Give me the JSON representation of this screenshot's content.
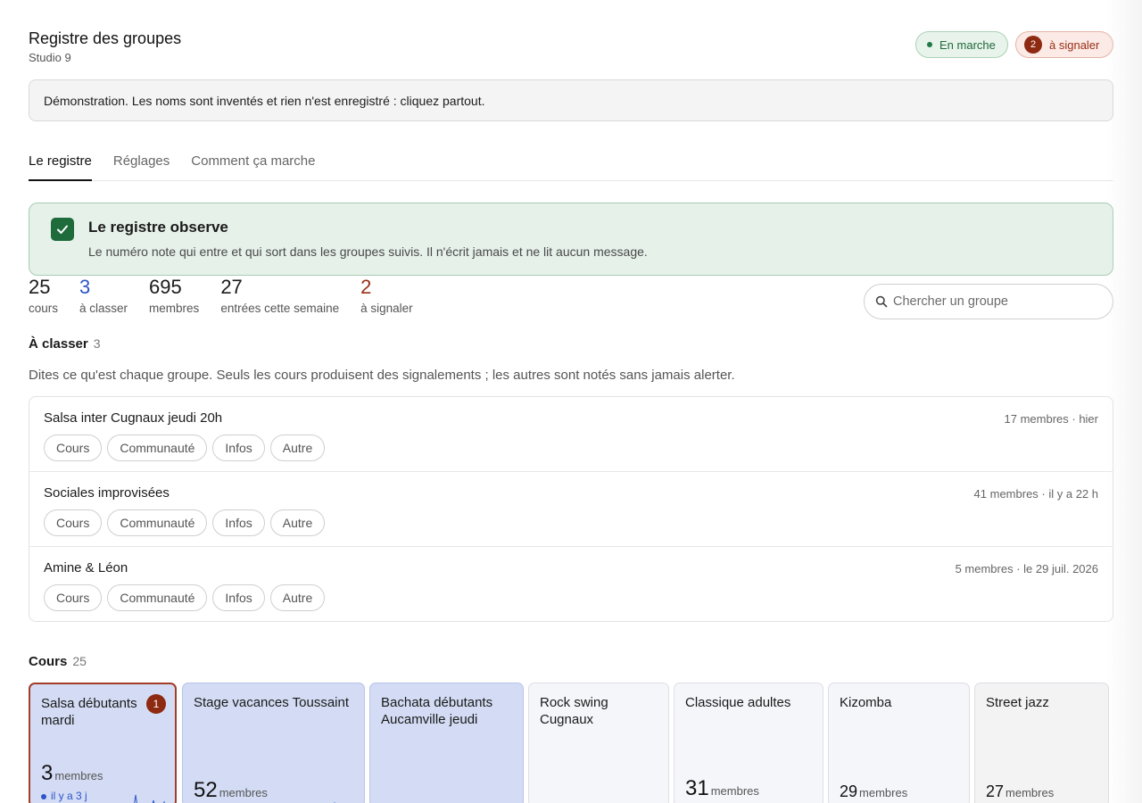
{
  "header": {
    "title": "Registre des groupes",
    "subtitle": "Studio 9",
    "status_running": "En marche",
    "report_count": "2",
    "report_label": "à signaler"
  },
  "banner": "Démonstration. Les noms sont inventés et rien n'est enregistré : cliquez partout.",
  "tabs": [
    {
      "label": "Le registre",
      "active": true
    },
    {
      "label": "Réglages",
      "active": false
    },
    {
      "label": "Comment ça marche",
      "active": false
    }
  ],
  "status_panel": {
    "title": "Le registre observe",
    "text": "Le numéro note qui entre et qui sort dans les groupes suivis. Il n'écrit jamais et ne lit aucun message."
  },
  "stats": [
    {
      "value": "25",
      "label": "cours",
      "tone": "default"
    },
    {
      "value": "3",
      "label": "à classer",
      "tone": "blue"
    },
    {
      "value": "695",
      "label": "membres",
      "tone": "default"
    },
    {
      "value": "27",
      "label": "entrées cette semaine",
      "tone": "default"
    },
    {
      "value": "2",
      "label": "à signaler",
      "tone": "red"
    }
  ],
  "search": {
    "placeholder": "Chercher un groupe"
  },
  "to_classify": {
    "title": "À classer",
    "count": "3",
    "description": "Dites ce qu'est chaque groupe. Seuls les cours produisent des signalements ; les autres sont notés sans jamais alerter.",
    "chips": [
      "Cours",
      "Communauté",
      "Infos",
      "Autre"
    ],
    "groups": [
      {
        "name": "Salsa inter Cugnaux jeudi 20h",
        "meta": "17 membres · hier"
      },
      {
        "name": "Sociales improvisées",
        "meta": "41 membres · il y a 22 h"
      },
      {
        "name": "Amine & Léon",
        "meta": "5 membres · le 29 juil. 2026"
      }
    ]
  },
  "courses": {
    "title": "Cours",
    "count": "25",
    "members_unit": "membres",
    "cards": [
      {
        "name": "Salsa débutants mardi",
        "members": "3",
        "badge": "1",
        "recent": "il y a 3 j",
        "tint": "blue",
        "alert": true
      },
      {
        "name": "Stage vacances Toussaint",
        "members": "52",
        "tint": "blue"
      },
      {
        "name": "Bachata débutants Aucamville jeudi",
        "members": "",
        "tint": "blue"
      },
      {
        "name": "Rock swing Cugnaux",
        "members": "",
        "tint": "grey"
      },
      {
        "name": "Classique adultes",
        "members": "31",
        "tint": "grey"
      },
      {
        "name": "Kizomba",
        "members": "29",
        "tint": "grey"
      },
      {
        "name": "Street jazz",
        "members": "27",
        "tint": "grey"
      }
    ]
  },
  "colors": {
    "accent_green": "#1e6b3b",
    "alert_red": "#8f2a12",
    "info_blue": "#2d55c8"
  }
}
